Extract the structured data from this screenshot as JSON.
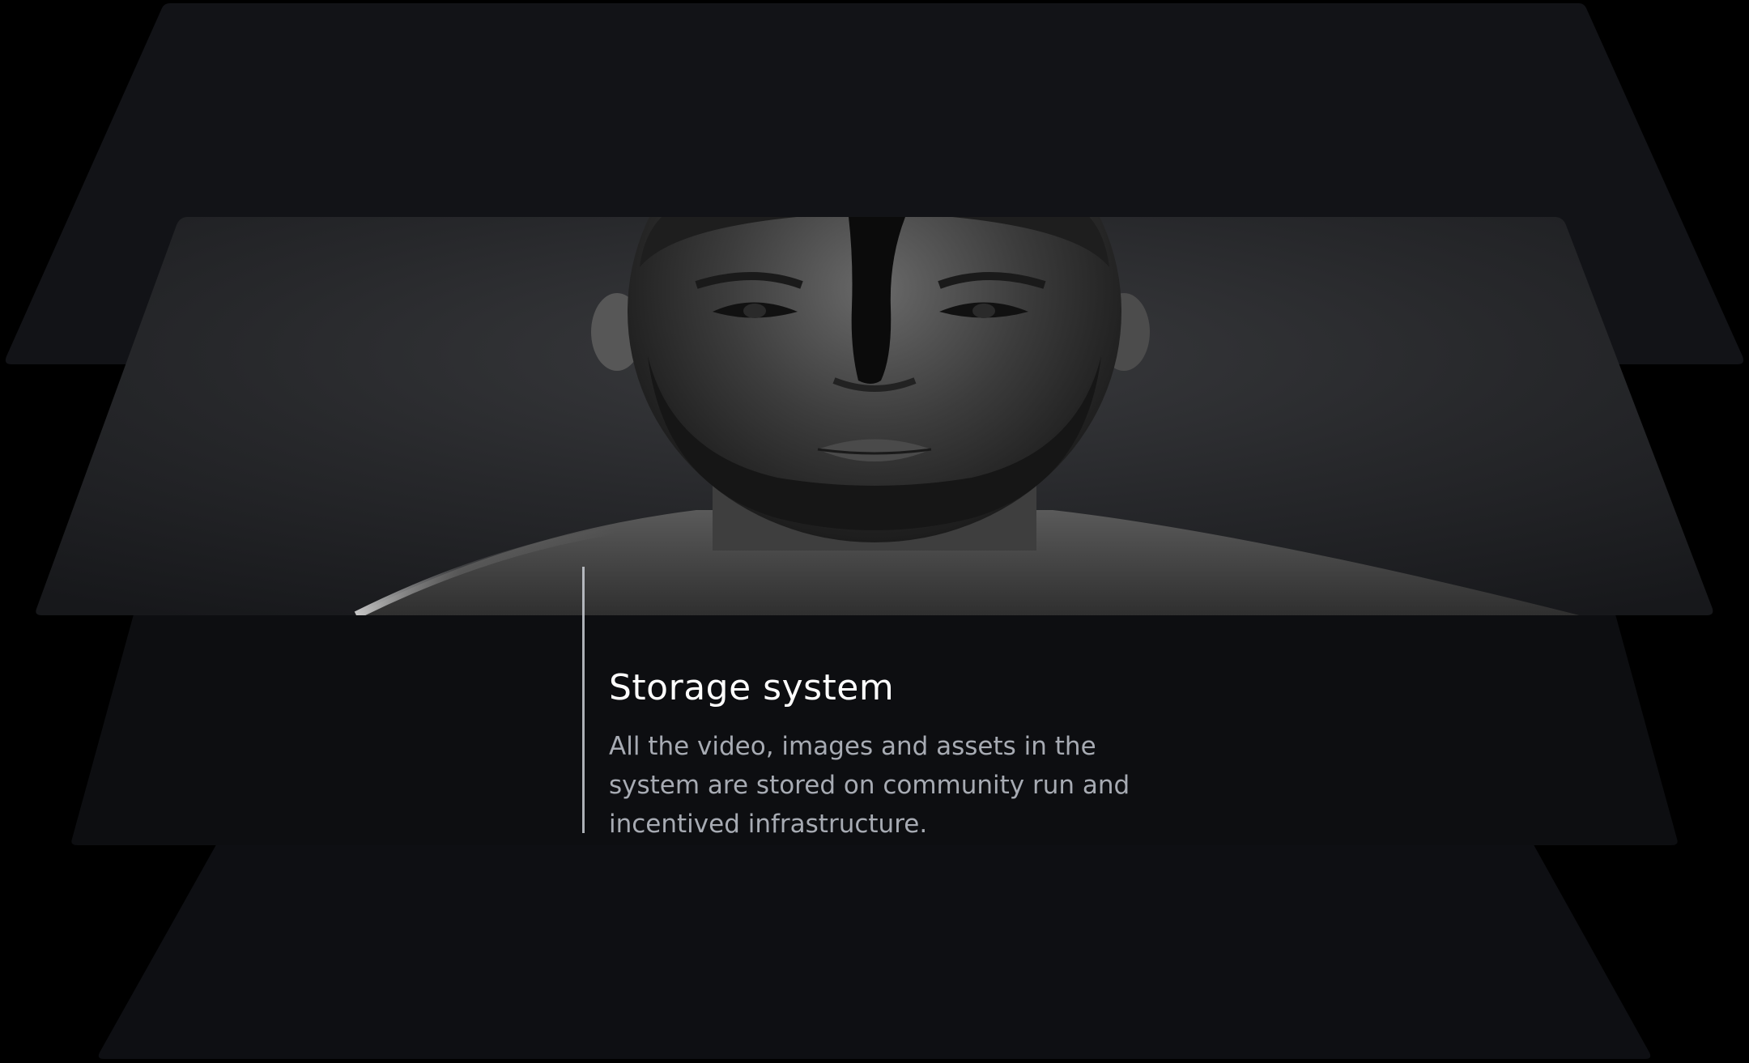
{
  "section": {
    "title": "Storage system",
    "description": "All the video, images and assets in the system are stored on community run and incentived infrastructure."
  },
  "image": {
    "subject": "portrait-photo",
    "tone": "monochrome"
  },
  "colors": {
    "background": "#000000",
    "layer_top": "#121317",
    "layer_bottom": "#0d0e12",
    "title_text": "#ffffff",
    "body_text": "#a7abb3",
    "divider": "#c9ccd3"
  }
}
